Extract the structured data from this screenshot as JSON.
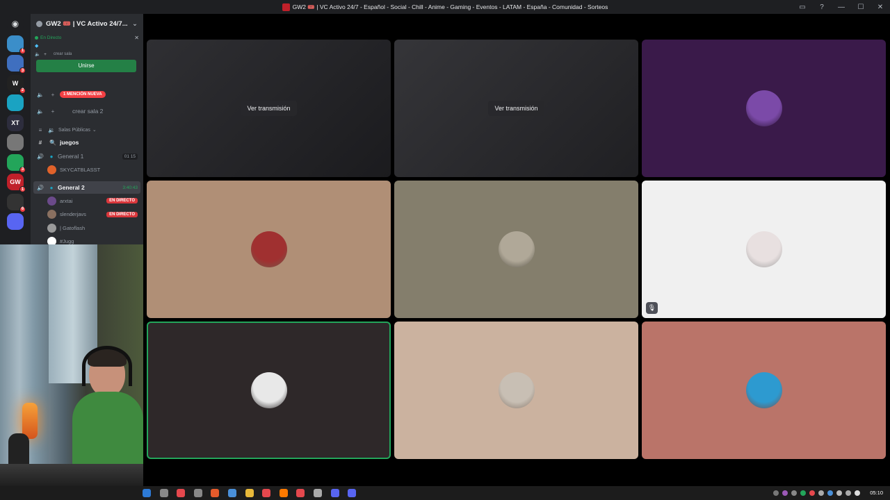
{
  "window": {
    "title": "GW2 🎟️ | VC Activo 24/7 - Español - Social - Chill - Anime - Gaming - Eventos - LATAM - España - Comunidad - Sorteos"
  },
  "servers": [
    {
      "icon": "discord-home-icon",
      "color": "#1e1f22",
      "badge": ""
    },
    {
      "icon": "server-icon",
      "color": "#3b8ec9",
      "badge": "1"
    },
    {
      "icon": "server-icon",
      "color": "#3f6fbf",
      "badge": "3"
    },
    {
      "icon": "server-icon",
      "color": "#222222",
      "badge": "2",
      "label": "W"
    },
    {
      "icon": "server-icon",
      "color": "#1aa3c2",
      "badge": ""
    },
    {
      "icon": "server-icon",
      "color": "#2d2d3d",
      "badge": "",
      "label": "XT"
    },
    {
      "icon": "server-icon",
      "color": "#777777",
      "badge": ""
    },
    {
      "icon": "server-icon",
      "color": "#23a55a",
      "badge": "3"
    },
    {
      "icon": "server-icon",
      "color": "#c0202a",
      "badge": "1",
      "label": "GW"
    },
    {
      "icon": "server-icon",
      "color": "#333333",
      "badge": "6"
    },
    {
      "icon": "server-icon",
      "color": "#5865f2",
      "badge": ""
    }
  ],
  "sidebar": {
    "guild_name": "GW2 🎟️ | VC Activo 24/7...",
    "live_label": "En Directo",
    "create_room_small": "crear sala",
    "join_button": "Unirse",
    "mention_pill": "1 MENCIÓN NUEVA",
    "create_room_2": "crear sala 2",
    "category": "Salas Públicas",
    "games_channel": "juegos",
    "general1": "General 1",
    "general1_counts": "01  15",
    "general1_user": "SKYCATBLASST",
    "general2": "General 2",
    "general2_time": "3:40:43",
    "users": [
      {
        "name": "arxtai",
        "live": "EN DIRECTO",
        "color": "#6b4a8a"
      },
      {
        "name": "slenderjavs",
        "live": "EN DIRECTO",
        "color": "#8a7060"
      },
      {
        "name": "| Gatoflash",
        "live": "",
        "color": "#9a9a9a"
      },
      {
        "name": "#Jugg",
        "live": "",
        "color": "#ffffff"
      }
    ]
  },
  "tiles": [
    {
      "name": "stream-tile-1",
      "button": "Ver transmisión",
      "bg": "#242428"
    },
    {
      "name": "stream-tile-2",
      "button": "Ver transmisión",
      "bg": "#2a2a2e"
    },
    {
      "name": "user-tile-3",
      "bg": "#3a1a4a",
      "avatar": "#7b4aa8"
    },
    {
      "name": "user-tile-4",
      "bg": "#b08f76",
      "avatar": "#a03030"
    },
    {
      "name": "user-tile-5",
      "bg": "#847e6c",
      "avatar": "#b0a898"
    },
    {
      "name": "user-tile-6",
      "bg": "#f0f0f0",
      "avatar": "#e8e0e0",
      "muted": true
    },
    {
      "name": "user-tile-7",
      "bg": "#2e2829",
      "avatar": "#e8e8e8",
      "speaking": true
    },
    {
      "name": "user-tile-8",
      "bg": "#cbb29f",
      "avatar": "#c8bfb4"
    },
    {
      "name": "user-tile-9",
      "bg": "#ba7469",
      "avatar": "#2d9ad0"
    }
  ],
  "taskbar": {
    "clock": "05:10"
  }
}
